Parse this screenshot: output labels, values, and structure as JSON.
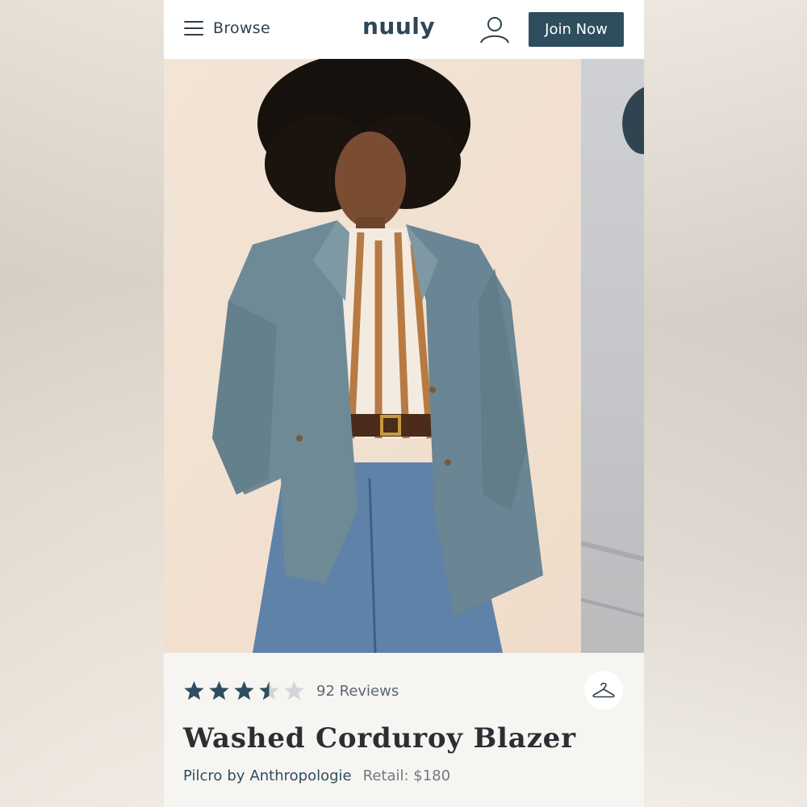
{
  "header": {
    "browse_label": "Browse",
    "logo": "nuuly",
    "join_label": "Join Now"
  },
  "product": {
    "rating": 3.5,
    "rating_max": 5,
    "reviews_label": "92 Reviews",
    "title": "Washed Corduroy Blazer",
    "brand": "Pilcro",
    "by": "by",
    "designer": "Anthropologie",
    "retail": "Retail: $180"
  },
  "icons": {
    "menu": "hamburger-icon",
    "account": "user-icon",
    "closet": "hanger-icon",
    "star": "star-icon"
  },
  "colors": {
    "brand_dark": "#2e4e5e",
    "star_filled": "#2e4e5e",
    "star_empty": "#d3d6d9",
    "photo_background": "#f2e2d2"
  }
}
